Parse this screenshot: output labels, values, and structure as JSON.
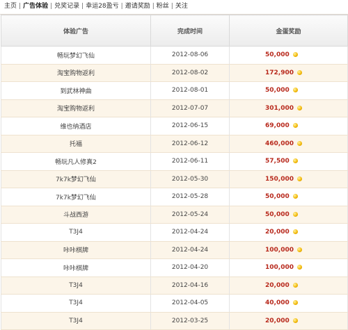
{
  "nav": {
    "items": [
      {
        "label": "主页",
        "active": false
      },
      {
        "label": "广告体验",
        "active": true
      },
      {
        "label": "兑奖记录",
        "active": false
      },
      {
        "label": "幸运28盈亏",
        "active": false
      },
      {
        "label": "邀请奖励",
        "active": false
      },
      {
        "label": "粉丝",
        "active": false
      },
      {
        "label": "关注",
        "active": false
      }
    ],
    "separator": "|"
  },
  "table": {
    "columns": [
      "体验广告",
      "完成时间",
      "金蛋奖励"
    ],
    "rows": [
      {
        "ad": "畅玩梦幻飞仙",
        "date": "2012-08-06",
        "reward": "50,000"
      },
      {
        "ad": "淘宝购物返利",
        "date": "2012-08-02",
        "reward": "172,900"
      },
      {
        "ad": "到武林神曲",
        "date": "2012-08-01",
        "reward": "50,000"
      },
      {
        "ad": "淘宝购物返利",
        "date": "2012-07-07",
        "reward": "301,000"
      },
      {
        "ad": "维也纳酒店",
        "date": "2012-06-15",
        "reward": "69,000"
      },
      {
        "ad": "托福",
        "date": "2012-06-12",
        "reward": "460,000"
      },
      {
        "ad": "畅玩凡人修真2",
        "date": "2012-06-11",
        "reward": "57,500"
      },
      {
        "ad": "7k7k梦幻飞仙",
        "date": "2012-05-30",
        "reward": "150,000"
      },
      {
        "ad": "7k7k梦幻飞仙",
        "date": "2012-05-28",
        "reward": "50,000"
      },
      {
        "ad": "斗战西游",
        "date": "2012-05-24",
        "reward": "50,000"
      },
      {
        "ad": "T3J4",
        "date": "2012-04-24",
        "reward": "20,000"
      },
      {
        "ad": "咔咔棋牌",
        "date": "2012-04-24",
        "reward": "100,000"
      },
      {
        "ad": "咔咔棋牌",
        "date": "2012-04-20",
        "reward": "100,000"
      },
      {
        "ad": "T3J4",
        "date": "2012-04-16",
        "reward": "20,000"
      },
      {
        "ad": "T3J4",
        "date": "2012-04-05",
        "reward": "40,000"
      },
      {
        "ad": "T3J4",
        "date": "2012-03-25",
        "reward": "20,000"
      }
    ]
  },
  "icons": {
    "reward": "gold-coin-icon"
  },
  "colors": {
    "reward_text": "#b8291c",
    "row_alt": "#fcf5e9",
    "coin": "#f2b705"
  }
}
